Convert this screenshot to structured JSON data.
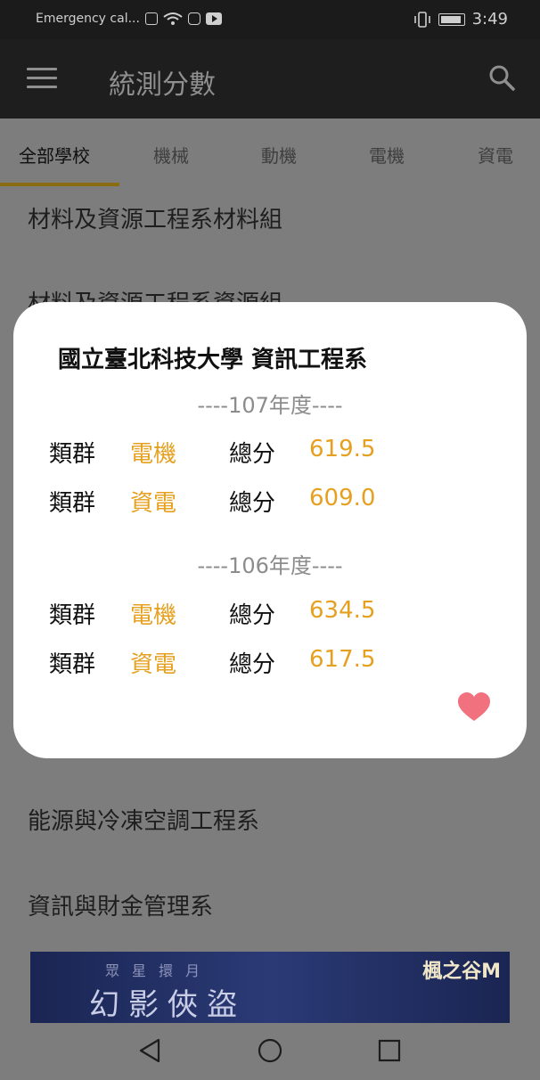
{
  "status_bar": {
    "carrier_text": "Emergency cal...",
    "time": "3:49"
  },
  "toolbar": {
    "title": "統測分數",
    "menu_icon": "hamburger-menu-icon",
    "search_icon": "search-icon"
  },
  "tabs": [
    {
      "label": "全部學校",
      "active": true
    },
    {
      "label": "機械",
      "active": false
    },
    {
      "label": "動機",
      "active": false
    },
    {
      "label": "電機",
      "active": false
    },
    {
      "label": "資電",
      "active": false
    }
  ],
  "list": [
    {
      "label": "材料及資源工程系材料組"
    },
    {
      "label": "材料及資源工程系資源組"
    },
    {
      "label": "能源與冷凍空調工程系"
    },
    {
      "label": "資訊與財金管理系"
    }
  ],
  "dialog": {
    "title": "國立臺北科技大學  資訊工程系",
    "years": [
      {
        "header": "----107年度----",
        "rows": [
          {
            "group_label": "類群",
            "group": "電機",
            "score_label": "總分",
            "score": "619.5"
          },
          {
            "group_label": "類群",
            "group": "資電",
            "score_label": "總分",
            "score": "609.0"
          }
        ]
      },
      {
        "header": "----106年度----",
        "rows": [
          {
            "group_label": "類群",
            "group": "電機",
            "score_label": "總分",
            "score": "634.5"
          },
          {
            "group_label": "類群",
            "group": "資電",
            "score_label": "總分",
            "score": "617.5"
          }
        ]
      }
    ],
    "favorite_icon": "heart-icon",
    "favorite_color": "#f1717f"
  },
  "ad": {
    "subtitle": "眾星擐月",
    "title": "幻影俠盜",
    "logo": "楓之谷M"
  },
  "colors": {
    "accent_score": "#e6a01f",
    "tab_indicator": "#8a6d10",
    "toolbar_bg": "#1e1e1e"
  }
}
